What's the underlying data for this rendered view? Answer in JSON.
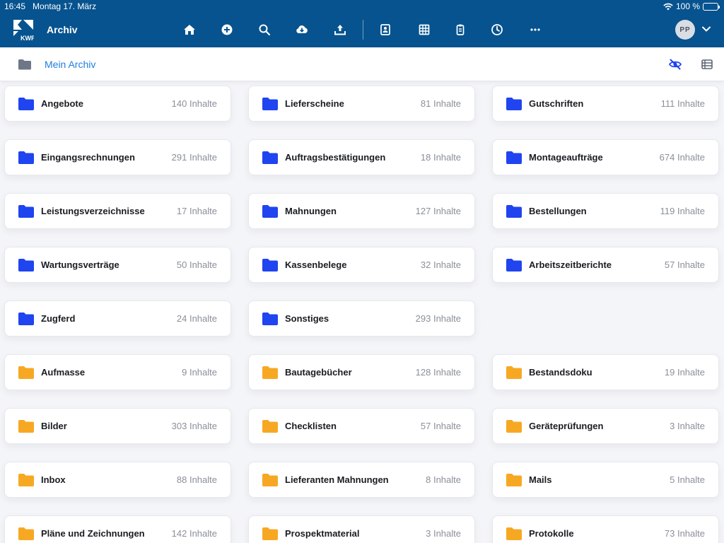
{
  "status": {
    "time": "16:45",
    "date": "Montag 17. März",
    "battery": "100 %"
  },
  "app": {
    "title": "Archiv",
    "logo_text": "KWP"
  },
  "nav": {
    "icons": [
      "home-icon",
      "add-icon",
      "search-icon",
      "cloud-download-icon",
      "upload-icon",
      "contact-card-icon",
      "grid-icon",
      "clipboard-icon",
      "clock-icon",
      "more-icon"
    ],
    "avatar_initials": "PP"
  },
  "breadcrumb": {
    "title": "Mein Archiv"
  },
  "colors": {
    "nav_bg": "#06538f",
    "folder_blue": "#1f44f0",
    "folder_orange": "#f7a823",
    "link": "#1f7fe0"
  },
  "folders": [
    {
      "name": "Angebote",
      "count": "140 Inhalte",
      "color": "blue"
    },
    {
      "name": "Lieferscheine",
      "count": "81 Inhalte",
      "color": "blue"
    },
    {
      "name": "Gutschriften",
      "count": "111 Inhalte",
      "color": "blue"
    },
    {
      "name": "Eingangsrechnungen",
      "count": "291 Inhalte",
      "color": "blue"
    },
    {
      "name": "Auftragsbestätigungen",
      "count": "18 Inhalte",
      "color": "blue"
    },
    {
      "name": "Montageaufträge",
      "count": "674 Inhalte",
      "color": "blue"
    },
    {
      "name": "Leistungsverzeichnisse",
      "count": "17 Inhalte",
      "color": "blue"
    },
    {
      "name": "Mahnungen",
      "count": "127 Inhalte",
      "color": "blue"
    },
    {
      "name": "Bestellungen",
      "count": "119 Inhalte",
      "color": "blue"
    },
    {
      "name": "Wartungsverträge",
      "count": "50 Inhalte",
      "color": "blue"
    },
    {
      "name": "Kassenbelege",
      "count": "32 Inhalte",
      "color": "blue"
    },
    {
      "name": "Arbeitszeitberichte",
      "count": "57 Inhalte",
      "color": "blue"
    },
    {
      "name": "Zugferd",
      "count": "24 Inhalte",
      "color": "blue"
    },
    {
      "name": "Sonstiges",
      "count": "293 Inhalte",
      "color": "blue"
    },
    null,
    {
      "name": "Aufmasse",
      "count": "9 Inhalte",
      "color": "orange"
    },
    {
      "name": "Bautagebücher",
      "count": "128 Inhalte",
      "color": "orange"
    },
    {
      "name": "Bestandsdoku",
      "count": "19 Inhalte",
      "color": "orange"
    },
    {
      "name": "Bilder",
      "count": "303 Inhalte",
      "color": "orange"
    },
    {
      "name": "Checklisten",
      "count": "57 Inhalte",
      "color": "orange"
    },
    {
      "name": "Geräteprüfungen",
      "count": "3 Inhalte",
      "color": "orange"
    },
    {
      "name": "Inbox",
      "count": "88 Inhalte",
      "color": "orange"
    },
    {
      "name": "Lieferanten Mahnungen",
      "count": "8 Inhalte",
      "color": "orange"
    },
    {
      "name": "Mails",
      "count": "5 Inhalte",
      "color": "orange"
    },
    {
      "name": "Pläne und Zeichnungen",
      "count": "142 Inhalte",
      "color": "orange"
    },
    {
      "name": "Prospektmaterial",
      "count": "3 Inhalte",
      "color": "orange"
    },
    {
      "name": "Protokolle",
      "count": "73 Inhalte",
      "color": "orange"
    }
  ]
}
